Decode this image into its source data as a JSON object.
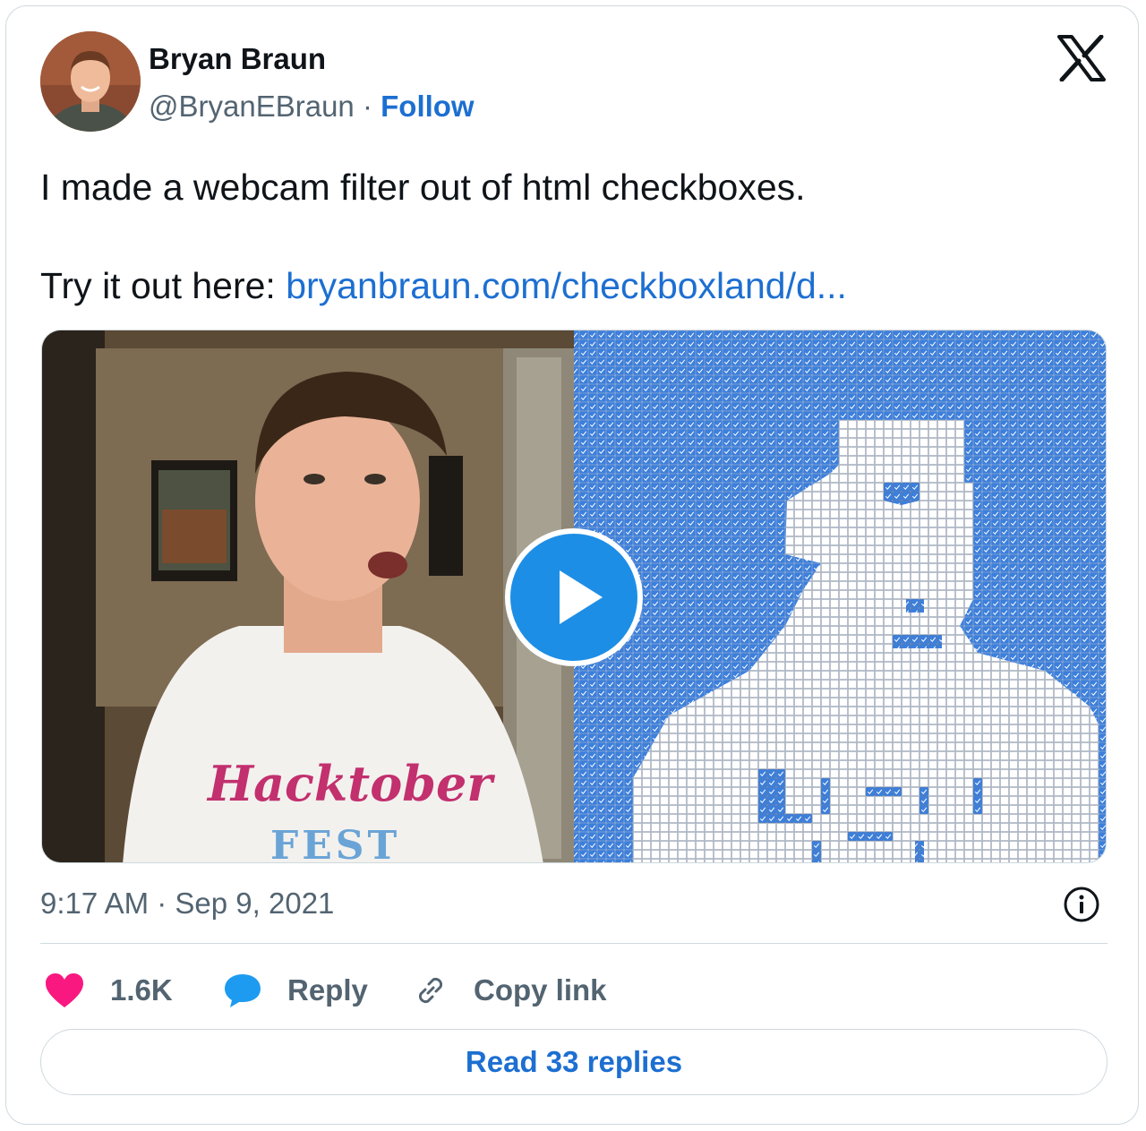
{
  "author": {
    "name": "Bryan Braun",
    "handle": "@BryanEBraun",
    "separator": "·",
    "follow_label": "Follow"
  },
  "tweet": {
    "text_line1": "I made a webcam filter out of html checkboxes.",
    "text_line2_prefix": "Try it out here: ",
    "link_text": "bryanbraun.com/checkboxland/d..."
  },
  "meta": {
    "time": "9:17 AM",
    "separator": "·",
    "date": "Sep 9, 2021"
  },
  "actions": {
    "like_count": "1.6K",
    "reply_label": "Reply",
    "copy_label": "Copy link"
  },
  "read_replies_label": "Read 33 replies",
  "icons": {
    "brand": "x-logo-icon",
    "like": "heart-icon",
    "reply": "speech-bubble-icon",
    "copy": "link-icon",
    "info": "info-icon",
    "play": "play-icon"
  },
  "colors": {
    "link": "#1d6fd1",
    "heart": "#f91880",
    "reply": "#1d9bf0",
    "checkbox_blue": "#3c7fdc",
    "secondary_text": "#536471",
    "border": "#cfd9de"
  }
}
